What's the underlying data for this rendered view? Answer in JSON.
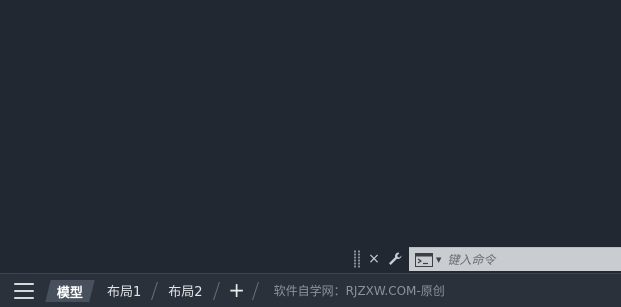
{
  "command_line": {
    "placeholder": "键入命令",
    "close_icon": "×",
    "customize_icon": "wrench-icon",
    "prompt_icon": "command-prompt-icon"
  },
  "status_bar": {
    "menu_icon": "hamburger-menu-icon",
    "tabs": [
      {
        "label": "模型",
        "active": true
      },
      {
        "label": "布局1",
        "active": false
      },
      {
        "label": "布局2",
        "active": false
      }
    ],
    "add_tab_label": "+",
    "watermark": "软件自学网：RJZXW.COM-原创"
  },
  "colors": {
    "canvas": "#222831",
    "status_bar": "#2a313b",
    "command_input_bg": "#c9ccd0",
    "active_tab": "#47505c"
  }
}
